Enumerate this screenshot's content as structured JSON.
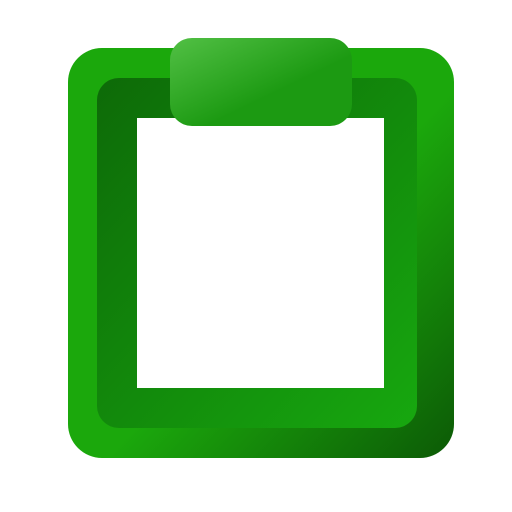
{
  "icon": {
    "name": "clipboard-icon",
    "colors": {
      "outer_light": "#1ba80c",
      "outer_dark": "#0c5a06",
      "inner_frame_dark": "#0d6a08",
      "inner_frame_light": "#17a80f",
      "clip_light": "#52c045",
      "clip_dark": "#1c9a12",
      "paper": "#ffffff",
      "background": "#ffffff"
    }
  }
}
